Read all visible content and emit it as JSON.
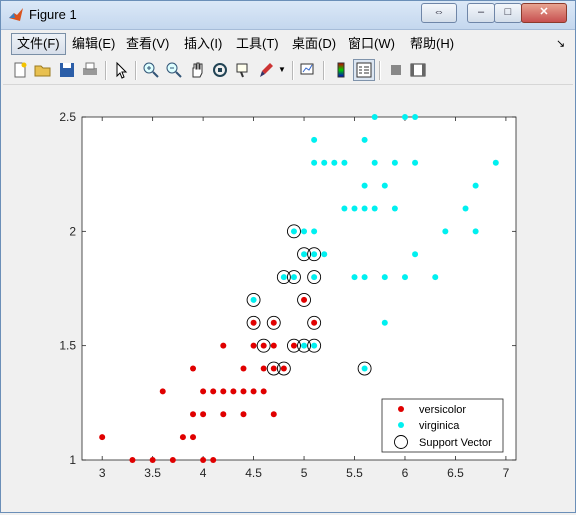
{
  "window": {
    "title": "Figure 1",
    "controls": [
      "⇔",
      "–",
      "□",
      "✕"
    ]
  },
  "menu": {
    "items": [
      "文件(F)",
      "编辑(E)",
      "查看(V)",
      "插入(I)",
      "工具(T)",
      "桌面(D)",
      "窗口(W)",
      "帮助(H)"
    ],
    "overflow": "↘"
  },
  "toolbar": {
    "icons": [
      "new-figure-icon",
      "open-file-icon",
      "save-icon",
      "print-icon",
      "pointer-icon",
      "zoom-in-icon",
      "zoom-out-icon",
      "pan-icon",
      "rotate-3d-icon",
      "data-cursor-icon",
      "brush-icon",
      "brush-dropdown-icon",
      "link-plot-icon",
      "colorbar-icon",
      "legend-icon",
      "hide-plot-tools-icon",
      "show-plot-tools-icon"
    ]
  },
  "colors": {
    "versicolor": "#e00000",
    "virginica": "#00f0f0",
    "support": "#000000"
  },
  "chart_data": {
    "type": "scatter",
    "title": "",
    "xlabel": "",
    "ylabel": "",
    "xlim": [
      2.8,
      7.1
    ],
    "ylim": [
      1.0,
      2.5
    ],
    "xticks": [
      3,
      3.5,
      4,
      4.5,
      5,
      5.5,
      6,
      6.5,
      7
    ],
    "xtick_labels": [
      "3",
      "3.5",
      "4",
      "4.5",
      "5",
      "5.5",
      "6",
      "6.5",
      "7"
    ],
    "yticks": [
      1,
      1.5,
      2,
      2.5
    ],
    "ytick_labels": [
      "1",
      "1.5",
      "2",
      "2.5"
    ],
    "grid": false,
    "legend_position": "bottom-right",
    "series": [
      {
        "name": "versicolor",
        "color": "#e00000",
        "marker": "dot",
        "points": [
          [
            3,
            1.1
          ],
          [
            3.3,
            1.0
          ],
          [
            3.5,
            1.0
          ],
          [
            3.7,
            1.0
          ],
          [
            4.0,
            1.0
          ],
          [
            4.1,
            1.0
          ],
          [
            3.8,
            1.1
          ],
          [
            3.9,
            1.1
          ],
          [
            3.9,
            1.2
          ],
          [
            4.0,
            1.2
          ],
          [
            4.2,
            1.2
          ],
          [
            4.4,
            1.2
          ],
          [
            4.7,
            1.2
          ],
          [
            4.0,
            1.3
          ],
          [
            4.1,
            1.3
          ],
          [
            4.2,
            1.3
          ],
          [
            4.3,
            1.3
          ],
          [
            4.4,
            1.3
          ],
          [
            4.5,
            1.3
          ],
          [
            4.6,
            1.3
          ],
          [
            3.6,
            1.3
          ],
          [
            3.9,
            1.4
          ],
          [
            4.4,
            1.4
          ],
          [
            4.6,
            1.4
          ],
          [
            4.7,
            1.4
          ],
          [
            4.8,
            1.4
          ],
          [
            4.2,
            1.5
          ],
          [
            4.5,
            1.5
          ],
          [
            4.6,
            1.5
          ],
          [
            4.7,
            1.5
          ],
          [
            4.9,
            1.5
          ],
          [
            4.5,
            1.6
          ],
          [
            4.7,
            1.6
          ],
          [
            5.1,
            1.6
          ],
          [
            5.0,
            1.7
          ]
        ]
      },
      {
        "name": "virginica",
        "color": "#00f0f0",
        "marker": "dot",
        "points": [
          [
            5.7,
            2.5
          ],
          [
            6.0,
            2.5
          ],
          [
            6.1,
            2.5
          ],
          [
            5.1,
            2.4
          ],
          [
            5.6,
            2.4
          ],
          [
            5.1,
            2.3
          ],
          [
            5.2,
            2.3
          ],
          [
            5.3,
            2.3
          ],
          [
            5.4,
            2.3
          ],
          [
            5.7,
            2.3
          ],
          [
            5.9,
            2.3
          ],
          [
            6.1,
            2.3
          ],
          [
            6.9,
            2.3
          ],
          [
            5.6,
            2.2
          ],
          [
            5.8,
            2.2
          ],
          [
            6.7,
            2.2
          ],
          [
            5.4,
            2.1
          ],
          [
            5.5,
            2.1
          ],
          [
            5.6,
            2.1
          ],
          [
            5.7,
            2.1
          ],
          [
            5.9,
            2.1
          ],
          [
            6.6,
            2.1
          ],
          [
            4.9,
            2.0
          ],
          [
            5.0,
            2.0
          ],
          [
            5.1,
            2.0
          ],
          [
            6.4,
            2.0
          ],
          [
            6.7,
            2.0
          ],
          [
            5.0,
            1.9
          ],
          [
            5.1,
            1.9
          ],
          [
            5.2,
            1.9
          ],
          [
            6.1,
            1.9
          ],
          [
            4.8,
            1.8
          ],
          [
            4.9,
            1.8
          ],
          [
            5.1,
            1.8
          ],
          [
            5.5,
            1.8
          ],
          [
            5.6,
            1.8
          ],
          [
            5.8,
            1.8
          ],
          [
            6.0,
            1.8
          ],
          [
            6.3,
            1.8
          ],
          [
            4.5,
            1.7
          ],
          [
            5.8,
            1.6
          ],
          [
            5.0,
            1.5
          ],
          [
            5.1,
            1.5
          ],
          [
            5.6,
            1.4
          ]
        ]
      },
      {
        "name": "Support Vector",
        "color": "#000000",
        "marker": "circle",
        "points": [
          [
            4.9,
            2.0
          ],
          [
            5.0,
            1.9
          ],
          [
            5.1,
            1.9
          ],
          [
            4.8,
            1.8
          ],
          [
            4.9,
            1.8
          ],
          [
            5.1,
            1.8
          ],
          [
            4.5,
            1.7
          ],
          [
            5.0,
            1.7
          ],
          [
            4.5,
            1.6
          ],
          [
            4.7,
            1.6
          ],
          [
            5.1,
            1.6
          ],
          [
            4.6,
            1.5
          ],
          [
            4.9,
            1.5
          ],
          [
            5.0,
            1.5
          ],
          [
            5.1,
            1.5
          ],
          [
            4.7,
            1.4
          ],
          [
            4.8,
            1.4
          ],
          [
            5.6,
            1.4
          ]
        ]
      }
    ]
  }
}
